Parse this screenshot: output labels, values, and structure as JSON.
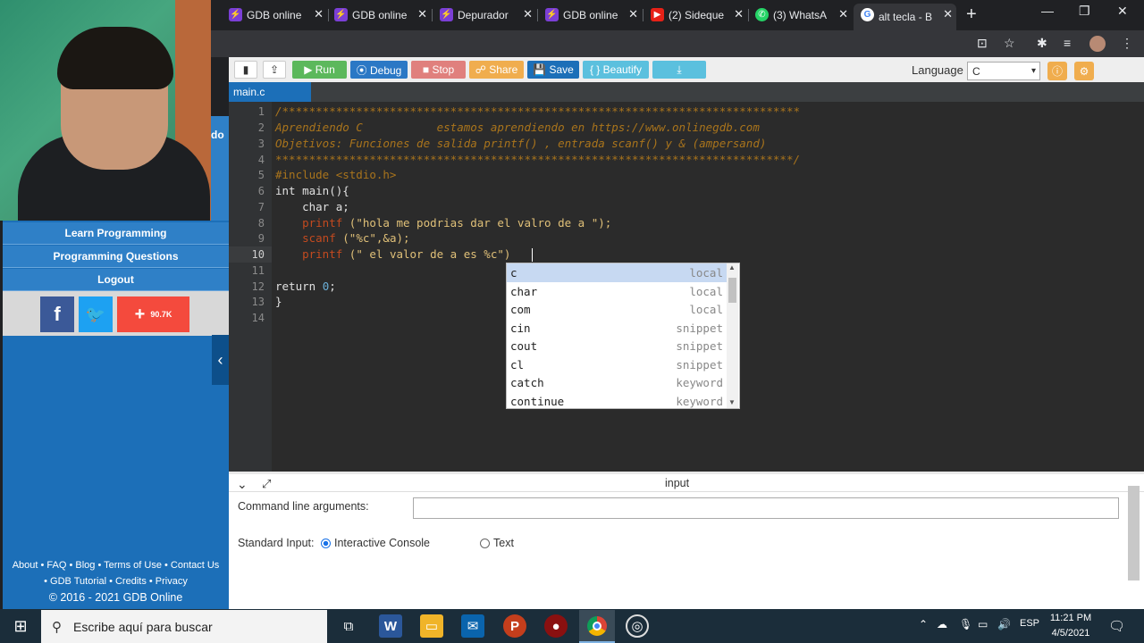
{
  "browser": {
    "tabs": [
      {
        "title": "GDB online",
        "icon": "gdb-icon"
      },
      {
        "title": "GDB online",
        "icon": "gdb-icon"
      },
      {
        "title": "Depurador",
        "icon": "gdb-icon"
      },
      {
        "title": "GDB online",
        "icon": "gdb-icon"
      },
      {
        "title": "(2) Sideque",
        "icon": "youtube-icon"
      },
      {
        "title": "(3) WhatsA",
        "icon": "whatsapp-icon"
      },
      {
        "title": "alt tecla - B",
        "icon": "google-icon"
      }
    ],
    "close_glyph": "✕",
    "new_tab_glyph": "+"
  },
  "sidebar": {
    "partial_text": "do",
    "links": [
      "Learn Programming",
      "Programming Questions",
      "Logout"
    ],
    "share_count": "90.7K",
    "footer_line1": "About • FAQ • Blog • Terms of Use • Contact Us",
    "footer_line2": "• GDB Tutorial • Credits • Privacy",
    "footer_line3": "© 2016 - 2021 GDB Online"
  },
  "toolbar": {
    "run": "▶ Run",
    "debug": "⦿ Debug",
    "stop": "■ Stop",
    "share": "☍ Share",
    "save": "💾 Save",
    "beautify": "{ } Beautify",
    "language_label": "Language",
    "language_value": "C"
  },
  "editor": {
    "file_tab": "main.c",
    "line_numbers": [
      "1",
      "2",
      "3",
      "4",
      "5",
      "6",
      "7",
      "8",
      "9",
      "10",
      "11",
      "12",
      "13",
      "14"
    ],
    "line1": "/*****************************************************************************",
    "line2": "Aprendiendo C           estamos aprendiendo en https://www.onlinegdb.com",
    "line3": "Objetivos: Funciones de salida printf() , entrada scanf() y & (ampersand)",
    "line4": "*****************************************************************************/",
    "line5_pp": "#include <stdio.h>",
    "line6": "int main(){",
    "line7": "    char a;",
    "line8_fn": "printf",
    "line8_rest": " (\"hola me podrias dar el valro de a \");",
    "line9_fn": "scanf",
    "line9_rest": " (\"%c\",&a);",
    "line10_fn": "printf",
    "line10_rest": " (\" el valor de a es %c\")",
    "line12_kw": "return ",
    "line12_num": "0",
    "line12_end": ";",
    "line13": "}"
  },
  "autocomplete": [
    {
      "word": "c",
      "kind": "local"
    },
    {
      "word": "char",
      "kind": "local"
    },
    {
      "word": "com",
      "kind": "local"
    },
    {
      "word": "cin",
      "kind": "snippet"
    },
    {
      "word": "cout",
      "kind": "snippet"
    },
    {
      "word": "cl",
      "kind": "snippet"
    },
    {
      "word": "catch",
      "kind": "keyword"
    },
    {
      "word": "continue",
      "kind": "keyword"
    }
  ],
  "input_panel": {
    "title": "input",
    "cla_label": "Command line arguments:",
    "stdin_label": "Standard Input:",
    "opt_interactive": "Interactive Console",
    "opt_text": "Text"
  },
  "taskbar": {
    "search_placeholder": "Escribe aquí para buscar",
    "language": "ESP",
    "time": "11:21 PM",
    "date": "4/5/2021"
  },
  "colors": {
    "run": "#5cb85c",
    "debug": "#2b78c5",
    "stop": "#d9534f",
    "share": "#f0ad4e",
    "save": "#1c6fb8",
    "beautify": "#5bc0de"
  }
}
